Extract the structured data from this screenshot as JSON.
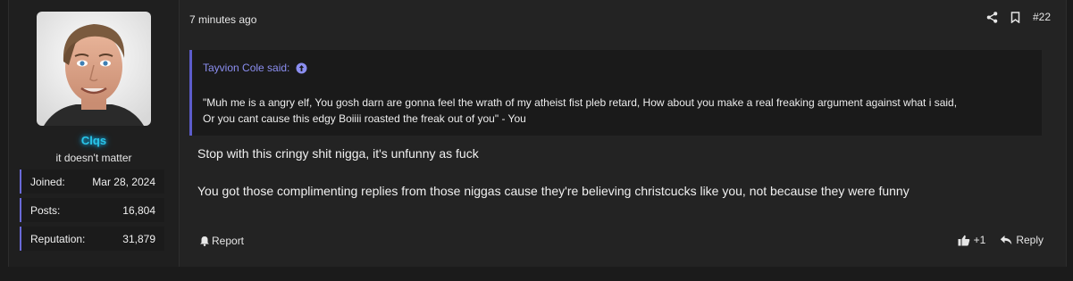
{
  "user": {
    "avatar_icon": "avatar-photo",
    "name": "Clqs",
    "name_color": "#29c6ea",
    "title": "it doesn't matter",
    "stats": [
      {
        "label": "Joined:",
        "value": "Mar 28, 2024"
      },
      {
        "label": "Posts:",
        "value": "16,804"
      },
      {
        "label": "Reputation:",
        "value": "31,879"
      }
    ]
  },
  "post": {
    "time": "7 minutes ago",
    "number": "#22",
    "quote": {
      "author": "Tayvion Cole said:",
      "text_line1": "\"Muh me is a angry elf, You gosh darn are gonna feel the wrath of my atheist fist pleb retard, How about you make a real freaking argument against what i said,",
      "text_line2": "Or you cant cause this edgy Boiiii roasted the freak out of you\" - You"
    },
    "message": [
      "Stop with this cringy shit nigga, it's unfunny as fuck",
      "You got those complimenting replies from those niggas cause they're believing christcucks like you, not because they were funny"
    ]
  },
  "footer": {
    "report_label": "Report",
    "like_count": "+1",
    "reply_label": "Reply"
  },
  "colors": {
    "accent": "#6a6ad8",
    "quote_link": "#8b8ef0"
  }
}
